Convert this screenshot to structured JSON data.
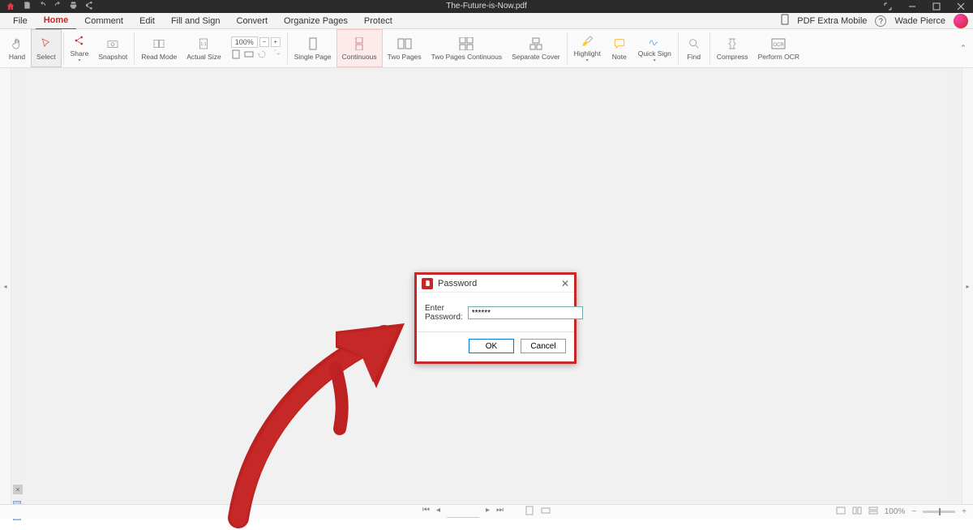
{
  "titlebar": {
    "filename": "The-Future-is-Now.pdf"
  },
  "menubar": {
    "items": [
      "File",
      "Home",
      "Comment",
      "Edit",
      "Fill and Sign",
      "Convert",
      "Organize Pages",
      "Protect"
    ],
    "activeIndex": 1,
    "mobile_label": "PDF Extra Mobile",
    "username": "Wade Pierce"
  },
  "ribbon": {
    "hand": "Hand",
    "select": "Select",
    "share": "Share",
    "snapshot": "Snapshot",
    "read_mode": "Read Mode",
    "actual_size": "Actual Size",
    "zoom_value": "100%",
    "single_page": "Single Page",
    "continuous": "Continuous",
    "two_pages": "Two Pages",
    "two_pages_continuous": "Two Pages Continuous",
    "separate_cover": "Separate Cover",
    "highlight": "Highlight",
    "note": "Note",
    "quick_sign": "Quick Sign",
    "find": "Find",
    "compress": "Compress",
    "perform_ocr": "Perform OCR"
  },
  "dialog": {
    "title": "Password",
    "label": "Enter Password:",
    "value": "******",
    "ok": "OK",
    "cancel": "Cancel"
  },
  "statusbar": {
    "zoom": "100%"
  }
}
